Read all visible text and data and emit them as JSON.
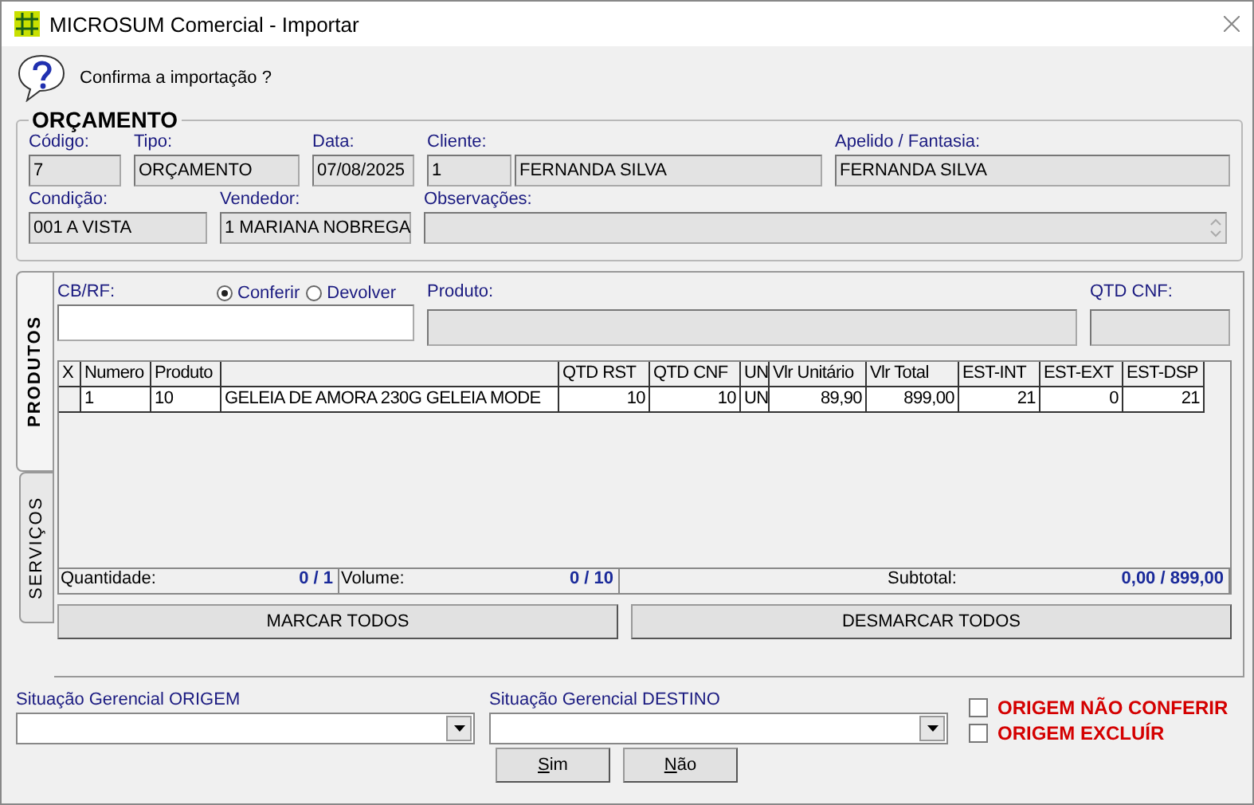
{
  "window": {
    "title": "MICROSUM Comercial - Importar"
  },
  "prompt": "Confirma a importação ?",
  "group": {
    "title": "ORÇAMENTO",
    "lines": [
      {
        "fields": [
          {
            "label": "Código:",
            "values": [
              "7"
            ]
          },
          {
            "label": "Tipo:",
            "values": [
              "ORÇAMENTO"
            ]
          },
          {
            "label": "Data:",
            "values": [
              "07/08/2025"
            ]
          },
          {
            "label": "Cliente:",
            "values": [
              "1",
              "FERNANDA SILVA"
            ]
          },
          {
            "label": "Apelido / Fantasia:",
            "values": [
              "FERNANDA SILVA"
            ]
          }
        ]
      },
      {
        "fields": [
          {
            "label": "Condição:",
            "values": [
              "001 A VISTA"
            ]
          },
          {
            "label": "Vendedor:",
            "values": [
              "1 MARIANA NOBREGA"
            ]
          },
          {
            "label": "Observações:",
            "kind": "memo"
          }
        ]
      }
    ]
  },
  "tabs": [
    {
      "label": "PRODUTOS",
      "selected": true
    },
    {
      "label": "SERVIÇOS",
      "selected": false
    }
  ],
  "entry": {
    "code_label": "CB/RF:",
    "modes": [
      {
        "label": "Conferir",
        "selected": true
      },
      {
        "label": "Devolver",
        "selected": false
      }
    ],
    "product_label": "Produto:",
    "qty_label": "QTD CNF:"
  },
  "table": {
    "columns": [
      "X",
      "Numero",
      "Produto",
      "",
      "QTD RST",
      "QTD CNF",
      "UN",
      "Vlr Unitário",
      "Vlr Total",
      "EST-INT",
      "EST-EXT",
      "EST-DSP"
    ],
    "rows": [
      [
        "",
        "1",
        "10",
        "GELEIA DE AMORA 230G GELEIA MODE",
        "10",
        "10",
        "UN",
        "89,90",
        "899,00",
        "21",
        "0",
        "21"
      ]
    ]
  },
  "summary": [
    {
      "label": "Quantidade:",
      "value": "0 / 1"
    },
    {
      "label": "Volume:",
      "value": "0 / 10"
    },
    {
      "label": "Subtotal:",
      "value": "0,00 / 899,00"
    }
  ],
  "grid_buttons": [
    "MARCAR TODOS",
    "DESMARCAR TODOS"
  ],
  "combos": [
    {
      "label": "Situação Gerencial ORIGEM"
    },
    {
      "label": "Situação Gerencial DESTINO"
    }
  ],
  "options": [
    {
      "label": "ORIGEM NÃO CONFERIR",
      "checked": false
    },
    {
      "label": "ORIGEM EXCLUÍR",
      "checked": false
    }
  ],
  "buttons": [
    "Sim",
    "Não"
  ]
}
